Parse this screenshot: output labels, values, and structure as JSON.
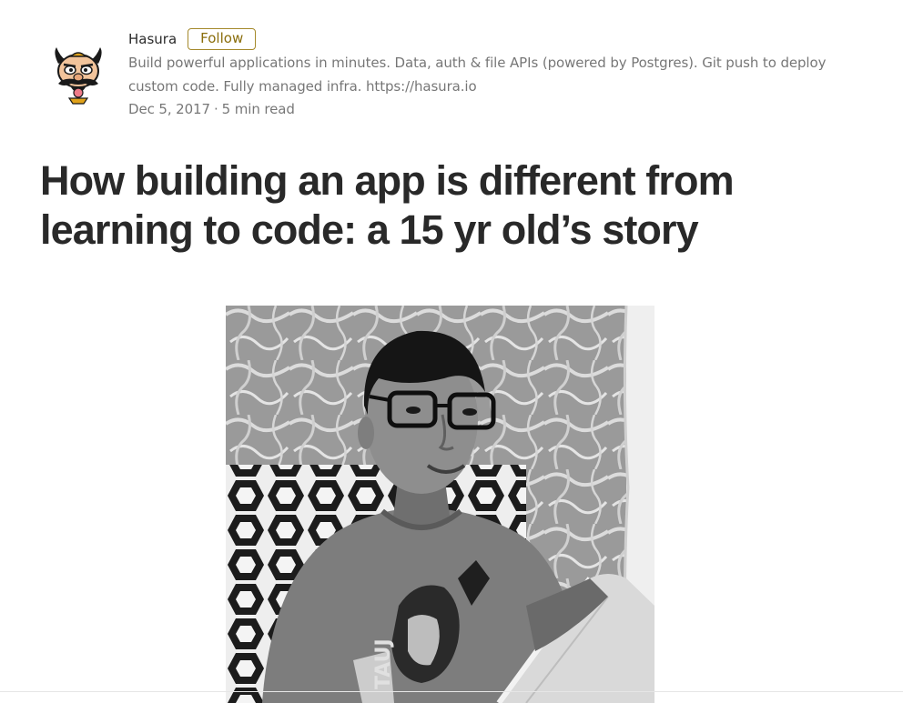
{
  "author": {
    "name": "Hasura",
    "follow_label": "Follow",
    "bio": "Build powerful applications in minutes. Data, auth & file APIs (powered by Postgres). Git push to deploy custom code. Fully managed infra. https://hasura.io",
    "avatar_icon": "hasura-mascot-icon"
  },
  "meta": {
    "date": "Dec 5, 2017",
    "separator": "·",
    "read_time": "5 min read"
  },
  "article": {
    "title": "How building an app is different from learning to code: a 15 yr old’s story"
  },
  "hero_image": {
    "style": "black-and-white photo",
    "shirt_text": "TAUJ"
  },
  "colors": {
    "follow_accent": "#8a6d0b",
    "text_primary": "#292929",
    "text_secondary": "#757575"
  }
}
